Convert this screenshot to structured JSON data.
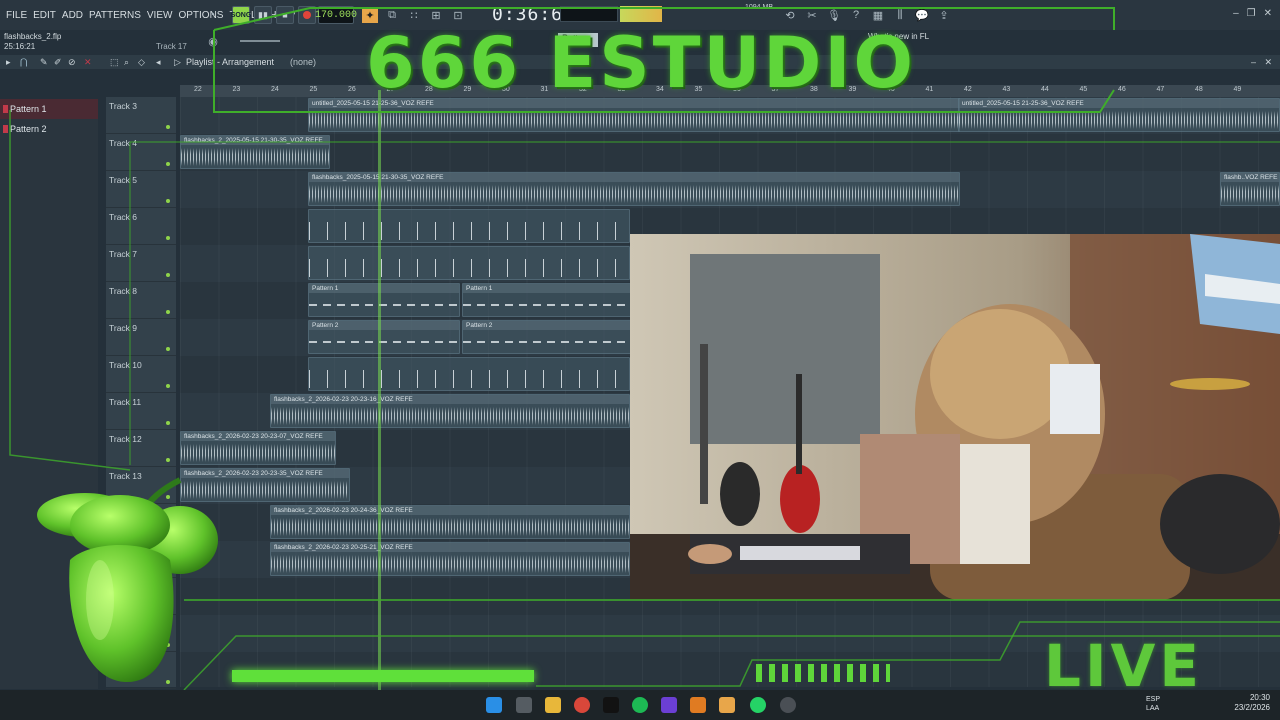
{
  "app": {
    "menu": [
      "FILE",
      "EDIT",
      "ADD",
      "PATTERNS",
      "VIEW",
      "OPTIONS",
      "TOOLS",
      "HELP"
    ],
    "song_mode_label": "SONG",
    "tempo": "170.000",
    "time": "0:36:62",
    "file_name": "flashbacks_2.flp",
    "timestamp": "25:16:21",
    "selected_track": "Track 17",
    "mem": "1094 MB",
    "hint_text": "What's new in FL",
    "pattern_selector": "Pattern 1"
  },
  "playlist": {
    "title": "Playlist - Arrangement",
    "pattern_label": "(none)",
    "patterns": [
      "Pattern 1",
      "Pattern 2"
    ],
    "ruler_marks": [
      "22",
      "23",
      "24",
      "25",
      "26",
      "27",
      "28",
      "29",
      "30",
      "31",
      "32",
      "33",
      "34",
      "35",
      "36",
      "37",
      "38",
      "39",
      "40",
      "41",
      "42",
      "43",
      "44",
      "45",
      "46",
      "47",
      "48",
      "49"
    ],
    "tracks": [
      "Track 3",
      "Track 4",
      "Track 5",
      "Track 6",
      "Track 7",
      "Track 8",
      "Track 9",
      "Track 10",
      "Track 11",
      "Track 12",
      "Track 13",
      "",
      "",
      "",
      "",
      "Track 18"
    ],
    "clips": [
      {
        "label": "untitled_2025-05-15 21-25-36_VOZ REFE",
        "row": 0,
        "kind": "wave"
      },
      {
        "label": "untitled_2025-05-15 21-25-36_VOZ REFE",
        "row": 0,
        "kind": "wave"
      },
      {
        "label": "flashbacks_2_2025-05-15 21-30-35_VOZ REFE",
        "row": 1,
        "kind": "wave"
      },
      {
        "label": "flashbacks_2025-05-15 21-30-35_VOZ REFE",
        "row": 2,
        "kind": "wave"
      },
      {
        "label": "flashb..VOZ REFE",
        "row": 2,
        "kind": "wave"
      },
      {
        "label": "",
        "row": 3,
        "kind": "hits"
      },
      {
        "label": "",
        "row": 4,
        "kind": "hits"
      },
      {
        "label": "Pattern 1",
        "row": 5,
        "kind": "dash"
      },
      {
        "label": "Pattern 1",
        "row": 5,
        "kind": "dash"
      },
      {
        "label": "Pattern 2",
        "row": 6,
        "kind": "dash"
      },
      {
        "label": "Pattern 2",
        "row": 6,
        "kind": "dash"
      },
      {
        "label": "",
        "row": 7,
        "kind": "hits"
      },
      {
        "label": "flashbacks_2_2026-02-23 20-23-16_VOZ REFE",
        "row": 8,
        "kind": "wave"
      },
      {
        "label": "flashbacks_2_2026-02-23 20-23-07_VOZ REFE",
        "row": 9,
        "kind": "wave"
      },
      {
        "label": "flashbacks_2_2026-02-23 20-23-35_VOZ REFE",
        "row": 10,
        "kind": "wave"
      },
      {
        "label": "flashbacks_2_2026-02-23 20-24-36_VOZ REFE",
        "row": 11,
        "kind": "wave"
      },
      {
        "label": "flashbacks_2_2026-02-23 20-25-21_VOZ REFE",
        "row": 12,
        "kind": "wave"
      }
    ]
  },
  "overlay": {
    "studio_title": "666 ESTUDIO",
    "live_label": "LIVE"
  },
  "taskbar": {
    "lang": "ESP",
    "lang_sub": "LAA",
    "time": "20:30",
    "date": "23/2/2026"
  },
  "colors": {
    "accent_green": "#5fd63a",
    "record_red": "#e0443a",
    "pattern_red": "#c23a4a"
  }
}
